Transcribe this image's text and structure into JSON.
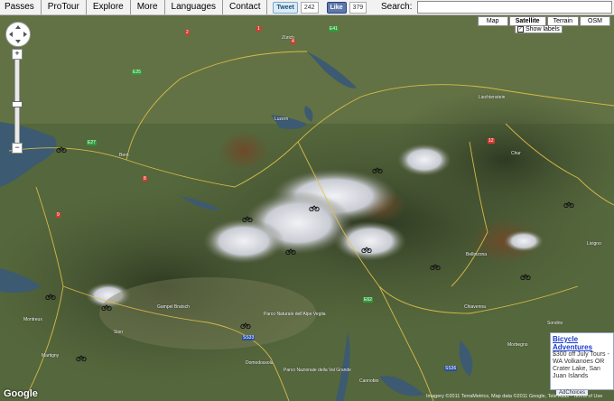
{
  "nav": {
    "items": [
      "Passes",
      "ProTour",
      "Explore",
      "More",
      "Languages",
      "Contact"
    ]
  },
  "share": {
    "tweet": "Tweet",
    "tweet_count": "242",
    "like": "Like",
    "like_count": "379"
  },
  "search": {
    "label": "Search:",
    "value": "",
    "placeholder": ""
  },
  "map_types": {
    "buttons": [
      "Map",
      "Satellite",
      "Terrain",
      "OSM"
    ],
    "active": "Satellite",
    "show_labels": "Show labels"
  },
  "places": [
    {
      "name": "Zürich"
    },
    {
      "name": "Luzern"
    },
    {
      "name": "Bern"
    },
    {
      "name": "Liechtenstein"
    },
    {
      "name": "Chur"
    },
    {
      "name": "Domodossola"
    },
    {
      "name": "Bellinzona"
    },
    {
      "name": "Chiavenna"
    },
    {
      "name": "Parco Naturale dell'Alpe Veglia"
    },
    {
      "name": "Parco Nazionale della Val Grande"
    },
    {
      "name": "Cannobio"
    },
    {
      "name": "Morbegno"
    },
    {
      "name": "Sondrio"
    },
    {
      "name": "Livigno"
    },
    {
      "name": "Gampel Bratsch"
    },
    {
      "name": "Montreux"
    },
    {
      "name": "Martigny"
    },
    {
      "name": "Sion"
    }
  ],
  "shields": [
    {
      "label": "2",
      "color": "red"
    },
    {
      "label": "1",
      "color": "red"
    },
    {
      "label": "4",
      "color": "red"
    },
    {
      "label": "E41",
      "color": "green"
    },
    {
      "label": "12",
      "color": "red"
    },
    {
      "label": "8",
      "color": "red"
    },
    {
      "label": "E25",
      "color": "green"
    },
    {
      "label": "E27",
      "color": "green"
    },
    {
      "label": "9",
      "color": "red"
    },
    {
      "label": "E62",
      "color": "green"
    },
    {
      "label": "SS33",
      "color": "blue"
    },
    {
      "label": "SS36",
      "color": "blue"
    }
  ],
  "ad": {
    "title": "Bicycle Adventures",
    "body": "$300 off July Tours - WA Volkanoes OR Crater Lake, San Juan Islands",
    "choices": "AdChoices"
  },
  "attribution": "Imagery ©2011 TerraMetrics, Map data ©2011 Google, Tele Atlas - Terms of Use",
  "google_logo": "Google",
  "colors": {
    "topbar": "#f2f2f2",
    "snow": "#e6e8ee",
    "lake": "#3c5a72",
    "shield_red": "#d43a30",
    "shield_green": "#2f9b3a"
  }
}
